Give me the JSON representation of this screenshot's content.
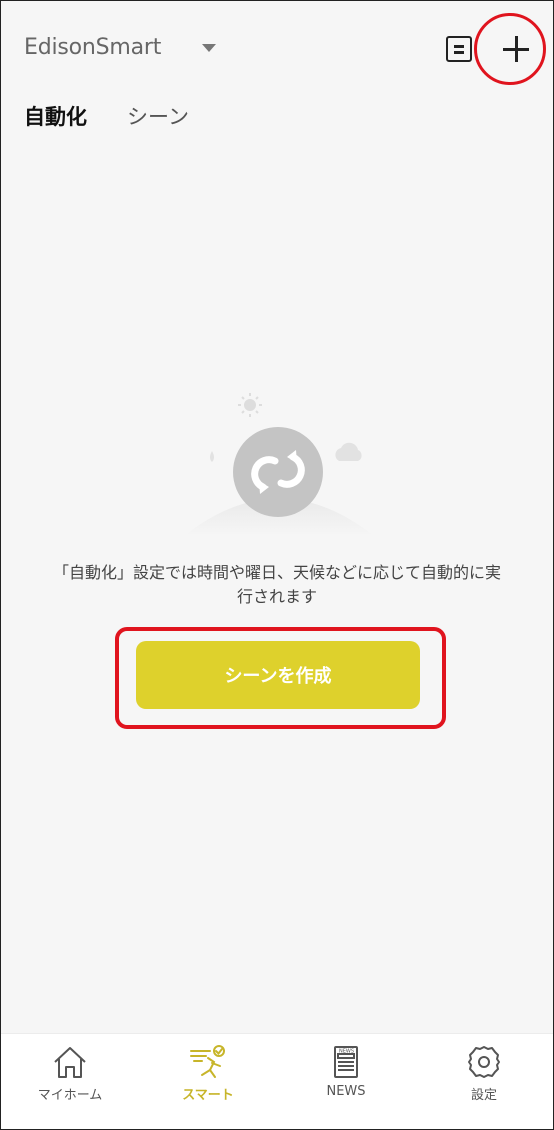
{
  "header": {
    "home_name": "EdisonSmart",
    "icons": {
      "dropdown": "caret-down-icon",
      "log": "log-icon",
      "add": "plus-icon"
    }
  },
  "tabs": [
    {
      "label": "自動化",
      "active": true
    },
    {
      "label": "シーン",
      "active": false
    }
  ],
  "empty_state": {
    "description_line1": "「自動化」設定では時間や曜日、天候などに応じて自動的に実",
    "description_line2": "行されます",
    "cta_label": "シーンを作成",
    "illustration_icon": "automation-loop-icon"
  },
  "bottom_nav": [
    {
      "label": "マイホーム",
      "icon": "home-icon",
      "active": false
    },
    {
      "label": "スマート",
      "icon": "smart-icon",
      "active": true
    },
    {
      "label": "NEWS",
      "icon": "news-icon",
      "active": false
    },
    {
      "label": "設定",
      "icon": "gear-icon",
      "active": false
    }
  ],
  "colors": {
    "accent": "#ded12c",
    "active_nav": "#c7b52a",
    "highlight": "#e0141e",
    "background": "#f6f6f6"
  }
}
